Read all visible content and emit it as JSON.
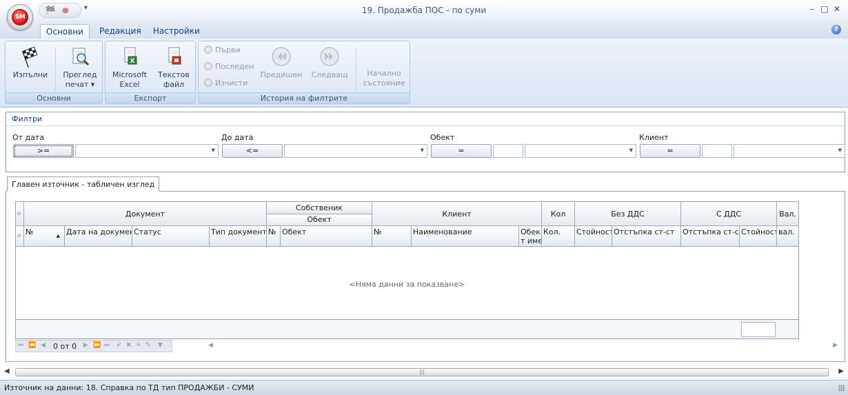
{
  "app": {
    "orb_label": "SM",
    "window_title": "19. Продажба ПОС - по суми",
    "controls": {
      "minimize": "–",
      "restore": "□",
      "close": "✕"
    },
    "qat_more": "▾"
  },
  "ribbon": {
    "tabs": [
      "Основни",
      "Редакция",
      "Настройки"
    ],
    "active_tab": "Основни",
    "help": "?",
    "groups": {
      "main": {
        "caption": "Основни",
        "run_line1": "Изпълни",
        "preview_line1": "Преглед",
        "preview_line2": "печат ▾"
      },
      "export": {
        "caption": "Експорт",
        "excel_line1": "Microsoft",
        "excel_line2": "Excel",
        "text_line1": "Текстов",
        "text_line2": "файл"
      },
      "history": {
        "caption": "История на филтрите",
        "first": "Първи",
        "last": "Последен",
        "clear": "Изчисти",
        "previous": "Предишен",
        "next": "Следващ",
        "initial_line1": "Начално",
        "initial_line2": "състояние"
      }
    }
  },
  "filters": {
    "title": "Филтри",
    "from_date": {
      "label": "От дата",
      "operator": ">="
    },
    "to_date": {
      "label": "До дата",
      "operator": "<="
    },
    "object": {
      "label": "Обект",
      "operator": "="
    },
    "client": {
      "label": "Клиент",
      "operator": "="
    }
  },
  "main_tab": {
    "label": "Главен източник - табличен изглед"
  },
  "grid": {
    "band_headers": {
      "document": "Документ",
      "owner": "Собственик",
      "object": "Обект",
      "client": "Клиент",
      "qty": "Кол",
      "no_vat": "Без ДДС",
      "with_vat": "С ДДС",
      "currency": "Вал."
    },
    "columns": {
      "doc_no": "№",
      "doc_date": "Дата на документ",
      "status": "Статус",
      "doc_type": "Тип документ",
      "obj_no": "№",
      "obj_name": "Обект",
      "client_no": "№",
      "client_name": "Наименование",
      "client_obj_1": "Обек",
      "client_obj_2": "т име",
      "qty": "Кол.",
      "value": "Стойност",
      "discount": "Отстъпка ст-ст",
      "vat_discount": "Отстъпка ст-ст",
      "vat_value": "Стойност",
      "currency": "вал."
    },
    "empty_text": "<Няма данни за показване>",
    "navigator_count": "0 от 0"
  },
  "statusbar": {
    "text": "Източник на данни: 18. Справка по ТД тип ПРОДАЖБИ - СУМИ"
  }
}
